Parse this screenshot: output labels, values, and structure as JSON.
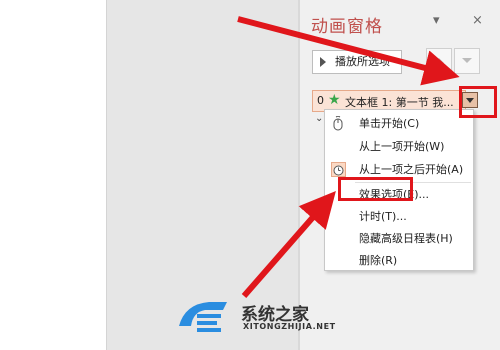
{
  "pane": {
    "title": "动画窗格",
    "play_label": "播放所选项",
    "colors": {
      "title": "#c0504d",
      "highlight": "#e0161b",
      "star": "#3aa64b"
    }
  },
  "item": {
    "number": "0",
    "text": "文本框 1: 第一节 我..."
  },
  "menu": {
    "items": [
      {
        "label": "单击开始(C)",
        "icon": "mouse-click-icon"
      },
      {
        "label": "从上一项开始(W)",
        "icon": ""
      },
      {
        "label": "从上一项之后开始(A)",
        "icon": "clock-icon"
      },
      {
        "label": "效果选项(E)...",
        "icon": ""
      },
      {
        "label": "计时(T)...",
        "icon": ""
      },
      {
        "label": "隐藏高级日程表(H)",
        "icon": ""
      },
      {
        "label": "删除(R)",
        "icon": ""
      }
    ]
  },
  "watermark": {
    "title": "系统之家",
    "url": "XITONGZHIJIA.NET"
  }
}
